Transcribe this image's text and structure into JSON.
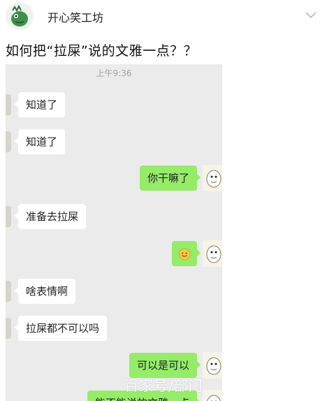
{
  "header": {
    "author": "开心笑工坊",
    "avatar_icon": "green-dinosaur-avatar-icon",
    "menu_icon": "chevron-down-icon"
  },
  "post": {
    "title": "如何把“拉屎”说的文雅一点？？"
  },
  "chat": {
    "timestamp": "上午9:36",
    "messages": [
      {
        "side": "left",
        "text": "知道了"
      },
      {
        "side": "left",
        "text": "知道了"
      },
      {
        "side": "right",
        "text": "你干嘛了"
      },
      {
        "side": "left",
        "text": "准备去拉屎"
      },
      {
        "side": "right",
        "text": "",
        "emoji": "smile-emoji-icon"
      },
      {
        "side": "left",
        "text": "啥表情啊"
      },
      {
        "side": "left",
        "text": "拉屎都不可以吗"
      },
      {
        "side": "right",
        "text": "可以是可以"
      },
      {
        "side": "right",
        "text": "能不能说的文雅一点"
      }
    ]
  },
  "watermark": "百家号/部门",
  "colors": {
    "chat_bg": "#ebebeb",
    "outgoing_bubble": "#95ec69",
    "incoming_bubble": "#ffffff"
  }
}
